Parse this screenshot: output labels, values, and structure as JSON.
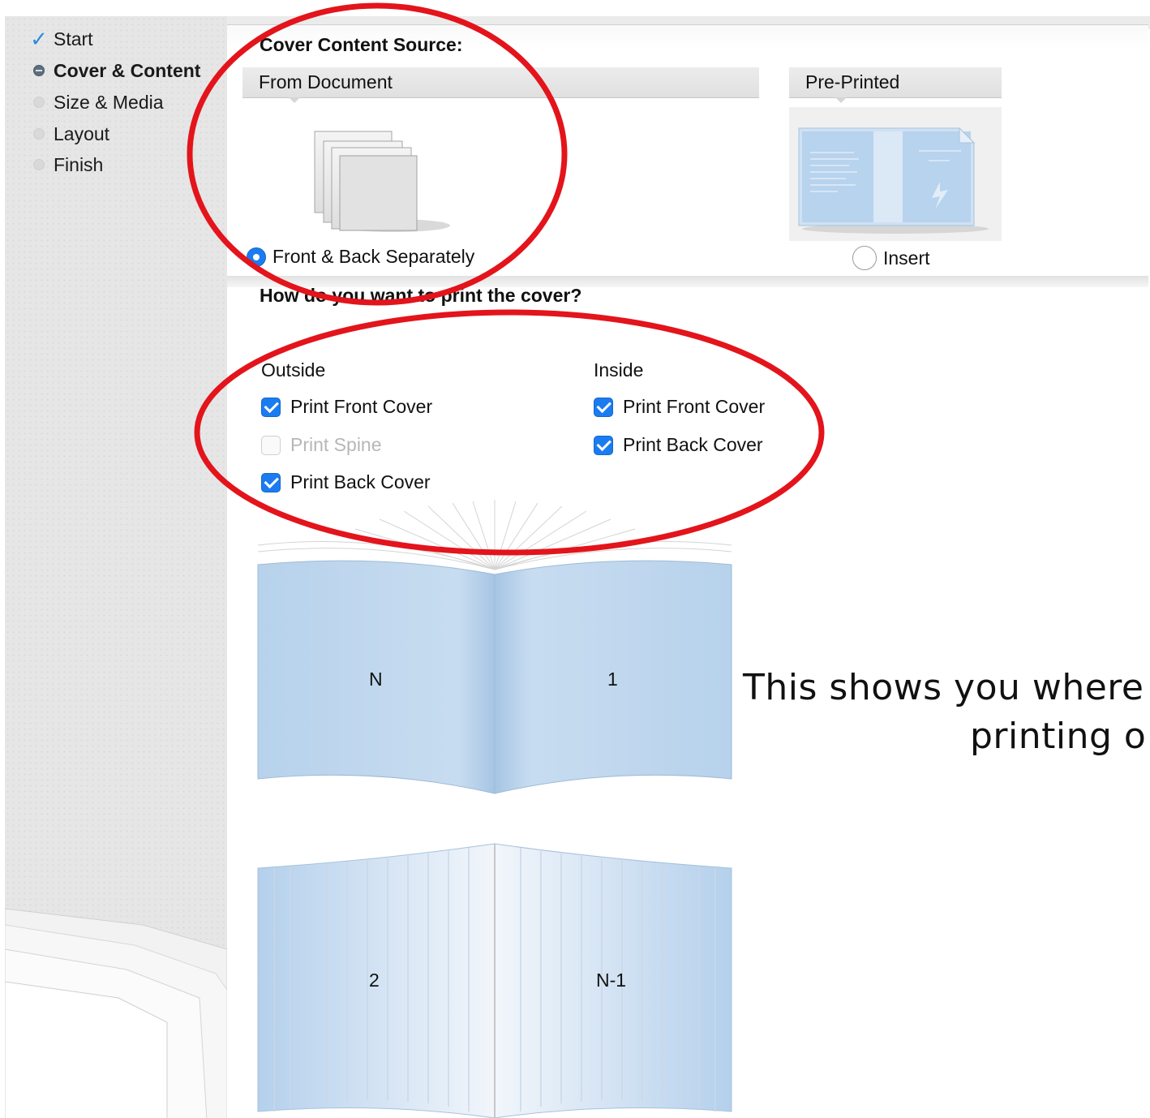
{
  "sidebar": {
    "items": [
      {
        "label": "Start",
        "state": "done",
        "icon": "checkmark-icon"
      },
      {
        "label": "Cover & Content",
        "state": "active",
        "icon": "current-step-icon"
      },
      {
        "label": "Size & Media",
        "state": "pending",
        "icon": "step-dot-icon"
      },
      {
        "label": "Layout",
        "state": "pending",
        "icon": "step-dot-icon"
      },
      {
        "label": "Finish",
        "state": "pending",
        "icon": "step-dot-icon"
      }
    ]
  },
  "cover_source": {
    "heading": "Cover Content Source:",
    "options": [
      {
        "tab_label": "From Document",
        "radio_label": "Front & Back Separately",
        "selected": true
      },
      {
        "tab_label": "Pre-Printed",
        "radio_label": "Insert",
        "selected": false
      }
    ]
  },
  "print_cover": {
    "heading": "How do you want to print the cover?",
    "outside": {
      "title": "Outside",
      "options": [
        {
          "label": "Print Front Cover",
          "checked": true,
          "enabled": true
        },
        {
          "label": "Print Spine",
          "checked": false,
          "enabled": false
        },
        {
          "label": "Print Back Cover",
          "checked": true,
          "enabled": true
        }
      ]
    },
    "inside": {
      "title": "Inside",
      "options": [
        {
          "label": "Print Front Cover",
          "checked": true,
          "enabled": true
        },
        {
          "label": "Print Back Cover",
          "checked": true,
          "enabled": true
        }
      ]
    }
  },
  "preview": {
    "outside_left": "N",
    "outside_right": "1",
    "inside_left": "2",
    "inside_right": "N-1"
  },
  "annotation": {
    "line1": "This shows you where i",
    "line2": "printing o"
  },
  "colors": {
    "accent": "#1a7cf0",
    "annotation_ellipse": "#e3141b",
    "book_blue": "#b9d4ec"
  }
}
